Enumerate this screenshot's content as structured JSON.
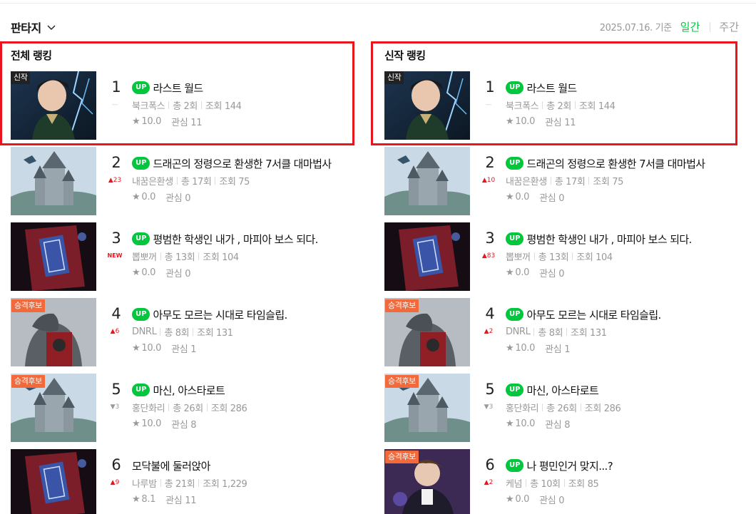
{
  "genre": {
    "label": "판타지"
  },
  "date_label": "2025.07.16. 기준",
  "tabs": {
    "daily": "일간",
    "weekly": "주간"
  },
  "columns": [
    {
      "title": "전체 랭킹",
      "items": [
        {
          "rank": "1",
          "change": "—",
          "up": "UP",
          "title": "라스트 월드",
          "author": "북크폭스",
          "episodes": "총 2회",
          "views": "조회 144",
          "rating": "10.0",
          "interest": "관심 11",
          "badge": "신작"
        },
        {
          "rank": "2",
          "change": "▲23",
          "up": "UP",
          "title": "드래곤의 정령으로 환생한 7서클 대마법사",
          "author": "내꿈은환생",
          "episodes": "총 17회",
          "views": "조회 75",
          "rating": "0.0",
          "interest": "관심 0",
          "badge": ""
        },
        {
          "rank": "3",
          "change": "NEW",
          "up": "UP",
          "title": "평범한 학생인 내가 , 마피아 보스 되다.",
          "author": "뽑뽀꺼",
          "episodes": "총 13회",
          "views": "조회 104",
          "rating": "0.0",
          "interest": "관심 0",
          "badge": ""
        },
        {
          "rank": "4",
          "change": "▲6",
          "up": "UP",
          "title": "아무도 모르는 시대로 타임슬립.",
          "author": "DNRL",
          "episodes": "총 8회",
          "views": "조회 131",
          "rating": "10.0",
          "interest": "관심 1",
          "badge": "승격후보"
        },
        {
          "rank": "5",
          "change": "▼3",
          "up": "UP",
          "title": "마신, 아스타로트",
          "author": "홍단화리",
          "episodes": "총 26회",
          "views": "조회 286",
          "rating": "10.0",
          "interest": "관심 8",
          "badge": "승격후보"
        },
        {
          "rank": "6",
          "change": "▲9",
          "up": "",
          "title": "모닥불에 둘러앉아",
          "author": "나루밤",
          "episodes": "총 21회",
          "views": "조회 1,229",
          "rating": "8.1",
          "interest": "관심 11",
          "badge": ""
        }
      ]
    },
    {
      "title": "신작 랭킹",
      "items": [
        {
          "rank": "1",
          "change": "—",
          "up": "UP",
          "title": "라스트 월드",
          "author": "북크폭스",
          "episodes": "총 2회",
          "views": "조회 144",
          "rating": "10.0",
          "interest": "관심 11",
          "badge": "신작"
        },
        {
          "rank": "2",
          "change": "▲10",
          "up": "UP",
          "title": "드래곤의 정령으로 환생한 7서클 대마법사",
          "author": "내꿈은환생",
          "episodes": "총 17회",
          "views": "조회 75",
          "rating": "0.0",
          "interest": "관심 0",
          "badge": ""
        },
        {
          "rank": "3",
          "change": "▲83",
          "up": "UP",
          "title": "평범한 학생인 내가 , 마피아 보스 되다.",
          "author": "뽑뽀꺼",
          "episodes": "총 13회",
          "views": "조회 104",
          "rating": "0.0",
          "interest": "관심 0",
          "badge": ""
        },
        {
          "rank": "4",
          "change": "▲2",
          "up": "UP",
          "title": "아무도 모르는 시대로 타임슬립.",
          "author": "DNRL",
          "episodes": "총 8회",
          "views": "조회 131",
          "rating": "10.0",
          "interest": "관심 1",
          "badge": "승격후보"
        },
        {
          "rank": "5",
          "change": "▼3",
          "up": "UP",
          "title": "마신, 아스타로트",
          "author": "홍단화리",
          "episodes": "총 26회",
          "views": "조회 286",
          "rating": "10.0",
          "interest": "관심 8",
          "badge": "승격후보"
        },
        {
          "rank": "6",
          "change": "▲2",
          "up": "UP",
          "title": "나 평민인거 맞지...?",
          "author": "케넘",
          "episodes": "총 10회",
          "views": "조회 85",
          "rating": "0.0",
          "interest": "관심 0",
          "badge": "승격후보"
        }
      ]
    }
  ],
  "colors": {
    "accent": "#00c73c",
    "highlight_box": "#e8151c",
    "promo_badge": "#f26a3c",
    "rank_up": "#e8151c"
  }
}
